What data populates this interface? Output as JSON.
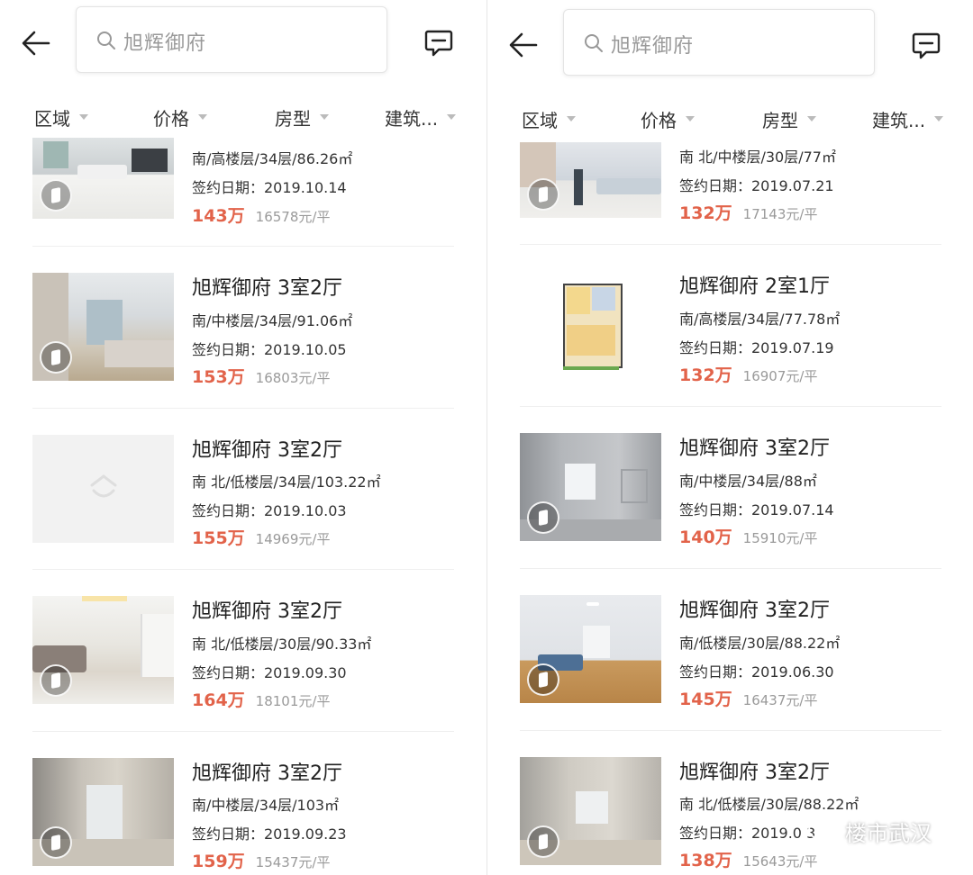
{
  "colors": {
    "accent": "#e2634a",
    "muted": "#9a9a9a",
    "divider": "#efefef"
  },
  "panels": [
    {
      "search_text": "旭辉御府",
      "filters": [
        {
          "label": "区域"
        },
        {
          "label": "价格"
        },
        {
          "label": "房型"
        },
        {
          "label": "建筑..."
        }
      ],
      "items": [
        {
          "title": "",
          "info": "南/高楼层/34层/86.26㎡",
          "date": "签约日期：2019.10.14",
          "price": "143万",
          "unit_price": "16578元/平",
          "thumb": "living-room-photo"
        },
        {
          "title": "旭辉御府 3室2厅",
          "info": "南/中楼层/34层/91.06㎡",
          "date": "签约日期：2019.10.05",
          "price": "153万",
          "unit_price": "16803元/平",
          "thumb": "living-room-photo"
        },
        {
          "title": "旭辉御府 3室2厅",
          "info": "南 北/低楼层/34层/103.22㎡",
          "date": "签约日期：2019.10.03",
          "price": "155万",
          "unit_price": "14969元/平",
          "thumb": "placeholder"
        },
        {
          "title": "旭辉御府 3室2厅",
          "info": "南 北/低楼层/30层/90.33㎡",
          "date": "签约日期：2019.09.30",
          "price": "164万",
          "unit_price": "18101元/平",
          "thumb": "living-room-photo"
        },
        {
          "title": "旭辉御府 3室2厅",
          "info": "南/中楼层/34层/103㎡",
          "date": "签约日期：2019.09.23",
          "price": "159万",
          "unit_price": "15437元/平",
          "thumb": "empty-room-photo"
        }
      ]
    },
    {
      "search_text": "旭辉御府",
      "filters": [
        {
          "label": "区域"
        },
        {
          "label": "价格"
        },
        {
          "label": "房型"
        },
        {
          "label": "建筑..."
        }
      ],
      "items": [
        {
          "title": "",
          "info": "南 北/中楼层/30层/77㎡",
          "date": "签约日期：2019.07.21",
          "price": "132万",
          "unit_price": "17143元/平",
          "thumb": "living-room-photo"
        },
        {
          "title": "旭辉御府 2室1厅",
          "info": "南/高楼层/34层/77.78㎡",
          "date": "签约日期：2019.07.19",
          "price": "132万",
          "unit_price": "16907元/平",
          "thumb": "floor-plan"
        },
        {
          "title": "旭辉御府 3室2厅",
          "info": "南/中楼层/34层/88㎡",
          "date": "签约日期：2019.07.14",
          "price": "140万",
          "unit_price": "15910元/平",
          "thumb": "empty-room-photo"
        },
        {
          "title": "旭辉御府 3室2厅",
          "info": "南/低楼层/30层/88.22㎡",
          "date": "签约日期：2019.06.30",
          "price": "145万",
          "unit_price": "16437元/平",
          "thumb": "living-room-photo"
        },
        {
          "title": "旭辉御府 3室2厅",
          "info": "南 北/低楼层/30层/88.22㎡",
          "date": "签约日期：2019.0 3",
          "price": "138万",
          "unit_price": "15643元/平",
          "thumb": "empty-room-photo"
        }
      ]
    }
  ],
  "watermark": {
    "text": "楼市武汉",
    "icon": "wechat-icon"
  }
}
